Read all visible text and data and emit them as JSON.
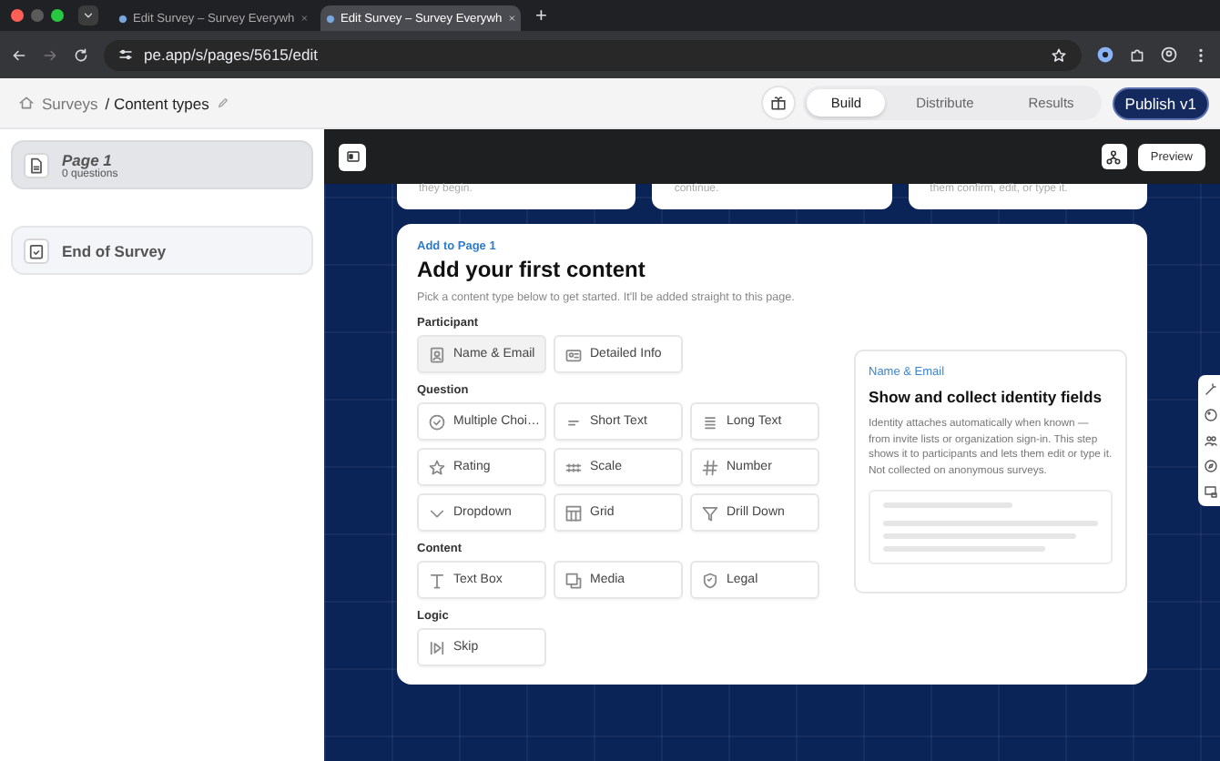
{
  "browser": {
    "tabs": [
      {
        "title": "Edit Survey – Survey Everywh",
        "selected": false
      },
      {
        "title": "Edit Survey – Survey Everywh",
        "selected": true
      }
    ],
    "new_tab": "+",
    "url": "pe.app/s/pages/5615/edit"
  },
  "header": {
    "breadcrumb_root": "Surveys",
    "breadcrumb_current": "/ Content types",
    "segments": [
      {
        "label": "Build",
        "selected": true
      },
      {
        "label": "Distribute",
        "selected": false
      },
      {
        "label": "Results",
        "selected": false
      }
    ],
    "publish_button": "Publish v1"
  },
  "sidebar": {
    "items": [
      {
        "title": "Page 1",
        "subtitle": "0 questions",
        "selected": true,
        "kind": "page"
      },
      {
        "title": "End of Survey",
        "selected": false,
        "kind": "end"
      }
    ]
  },
  "canvas": {
    "preview_button": "Preview",
    "top_cards": [
      "they begin.",
      "continue.",
      "them confirm, edit, or type it."
    ],
    "panel": {
      "eyebrow": "Add to Page 1",
      "title": "Add your first content",
      "description": "Pick a content type below to get started. It'll be added straight to this page.",
      "sections": [
        {
          "heading": "Participant",
          "items": [
            {
              "label": "Name & Email",
              "selected": true
            },
            {
              "label": "Detailed Info",
              "selected": false
            }
          ]
        },
        {
          "heading": "Question",
          "items": [
            {
              "label": "Multiple Choi…",
              "selected": false
            },
            {
              "label": "Short Text",
              "selected": false
            },
            {
              "label": "Long Text",
              "selected": false
            },
            {
              "label": "Rating",
              "selected": false
            },
            {
              "label": "Scale",
              "selected": false
            },
            {
              "label": "Number",
              "selected": false
            },
            {
              "label": "Dropdown",
              "selected": false
            },
            {
              "label": "Grid",
              "selected": false
            },
            {
              "label": "Drill Down",
              "selected": false
            }
          ]
        },
        {
          "heading": "Content",
          "items": [
            {
              "label": "Text Box",
              "selected": false
            },
            {
              "label": "Media",
              "selected": false
            },
            {
              "label": "Legal",
              "selected": false
            }
          ]
        },
        {
          "heading": "Logic",
          "items": [
            {
              "label": "Skip",
              "selected": false
            }
          ]
        }
      ],
      "detail": {
        "eyebrow": "Name & Email",
        "title": "Show and collect identity fields",
        "description": "Identity attaches automatically when known — from invite lists or organization sign-in. This step shows it to participants and lets them edit or type it. Not collected on anonymous surveys."
      }
    }
  }
}
